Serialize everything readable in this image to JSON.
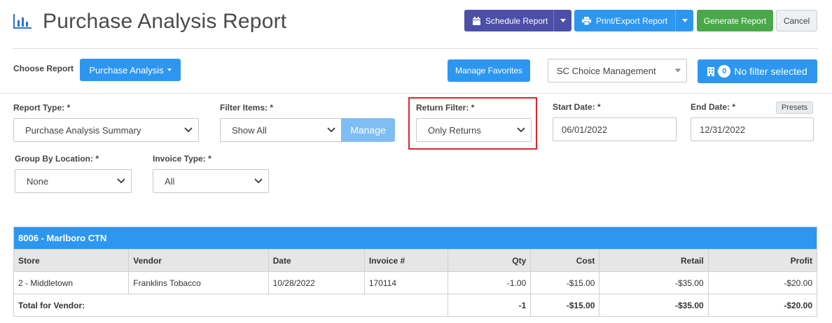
{
  "page": {
    "title": "Purchase Analysis Report"
  },
  "icons": {
    "title": "bar-chart-icon",
    "calendar": "calendar-icon",
    "print": "printer-icon",
    "building": "building-icon"
  },
  "colors": {
    "purple": "#4b4fa8",
    "blue": "#2d96f0",
    "green": "#4aa84a",
    "highlight": "#d9262c"
  },
  "toolbar": {
    "schedule_label": "Schedule Report",
    "print_label": "Print/Export Report",
    "generate_label": "Generate Report",
    "cancel_label": "Cancel"
  },
  "report_bar": {
    "choose_label": "Choose Report",
    "report_dropdown": "Purchase Analysis",
    "manage_favorites": "Manage Favorites",
    "company_select": "SC Choice Management",
    "filter_count": "0",
    "filter_text": "No filter selected"
  },
  "filters": {
    "report_type": {
      "label": "Report Type: *",
      "value": "Purchase Analysis Summary"
    },
    "filter_items": {
      "label": "Filter Items: *",
      "value": "Show All",
      "manage": "Manage"
    },
    "return_filter": {
      "label": "Return Filter: *",
      "value": "Only Returns"
    },
    "start_date": {
      "label": "Start Date: *",
      "value": "06/01/2022"
    },
    "end_date": {
      "label": "End Date: *",
      "value": "12/31/2022",
      "presets": "Presets"
    },
    "group_by_location": {
      "label": "Group By Location: *",
      "value": "None"
    },
    "invoice_type": {
      "label": "Invoice Type: *",
      "value": "All"
    }
  },
  "table": {
    "group_title": "8006 - Marlboro CTN",
    "columns": [
      "Store",
      "Vendor",
      "Date",
      "Invoice #",
      "Qty",
      "Cost",
      "Retail",
      "Profit"
    ],
    "rows": [
      [
        "2 - Middletown",
        "Franklins Tobacco",
        "10/28/2022",
        "170114",
        "-1.00",
        "-$15.00",
        "-$35.00",
        "-$20.00"
      ]
    ],
    "total": {
      "label": "Total for Vendor:",
      "qty": "-1",
      "cost": "-$15.00",
      "retail": "-$35.00",
      "profit": "-$20.00"
    }
  }
}
